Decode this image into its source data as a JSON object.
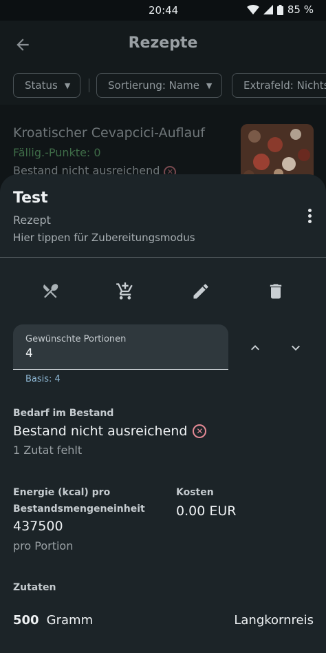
{
  "status_bar": {
    "time": "20:44",
    "battery": "85 %"
  },
  "app_bar": {
    "title": "Rezepte"
  },
  "filters": {
    "status": "Status",
    "sort": "Sortierung: Name",
    "extra": "Extrafeld: Nichts"
  },
  "list_item": {
    "title": "Kroatischer Cevapcici-Auflauf",
    "points": "Fällig.-Punkte: 0",
    "stock": "Bestand nicht ausreichend"
  },
  "sheet": {
    "title": "Test",
    "subtitle": "Rezept",
    "hint": "Hier tippen für Zubereitungsmodus",
    "servings": {
      "label": "Gewünschte Portionen",
      "value": "4",
      "basis": "Basis: 4"
    },
    "stock_section": {
      "label": "Bedarf im Bestand",
      "status": "Bestand nicht ausreichend",
      "missing": "1 Zutat fehlt"
    },
    "energy": {
      "label_line1": "Energie (kcal) pro",
      "label_line2": "Bestandsmengeneinheit",
      "value": "437500",
      "unit": "pro Portion"
    },
    "costs": {
      "label": "Kosten",
      "value": "0.00 EUR"
    },
    "ingredients": {
      "label": "Zutaten",
      "items": [
        {
          "amount": "500",
          "unit": "Gramm",
          "name": "Langkornreis"
        }
      ]
    }
  },
  "icons": [
    "back-arrow-icon",
    "chevron-down-icon",
    "cutlery-icon",
    "cart-add-icon",
    "pencil-icon",
    "trash-icon",
    "more-vert-icon",
    "chevron-up-icon",
    "close-circle-icon"
  ],
  "colors": {
    "accent_blue": "#8fb9d6",
    "error_pink": "#e58a95",
    "sheet_bg": "#1c2428"
  }
}
